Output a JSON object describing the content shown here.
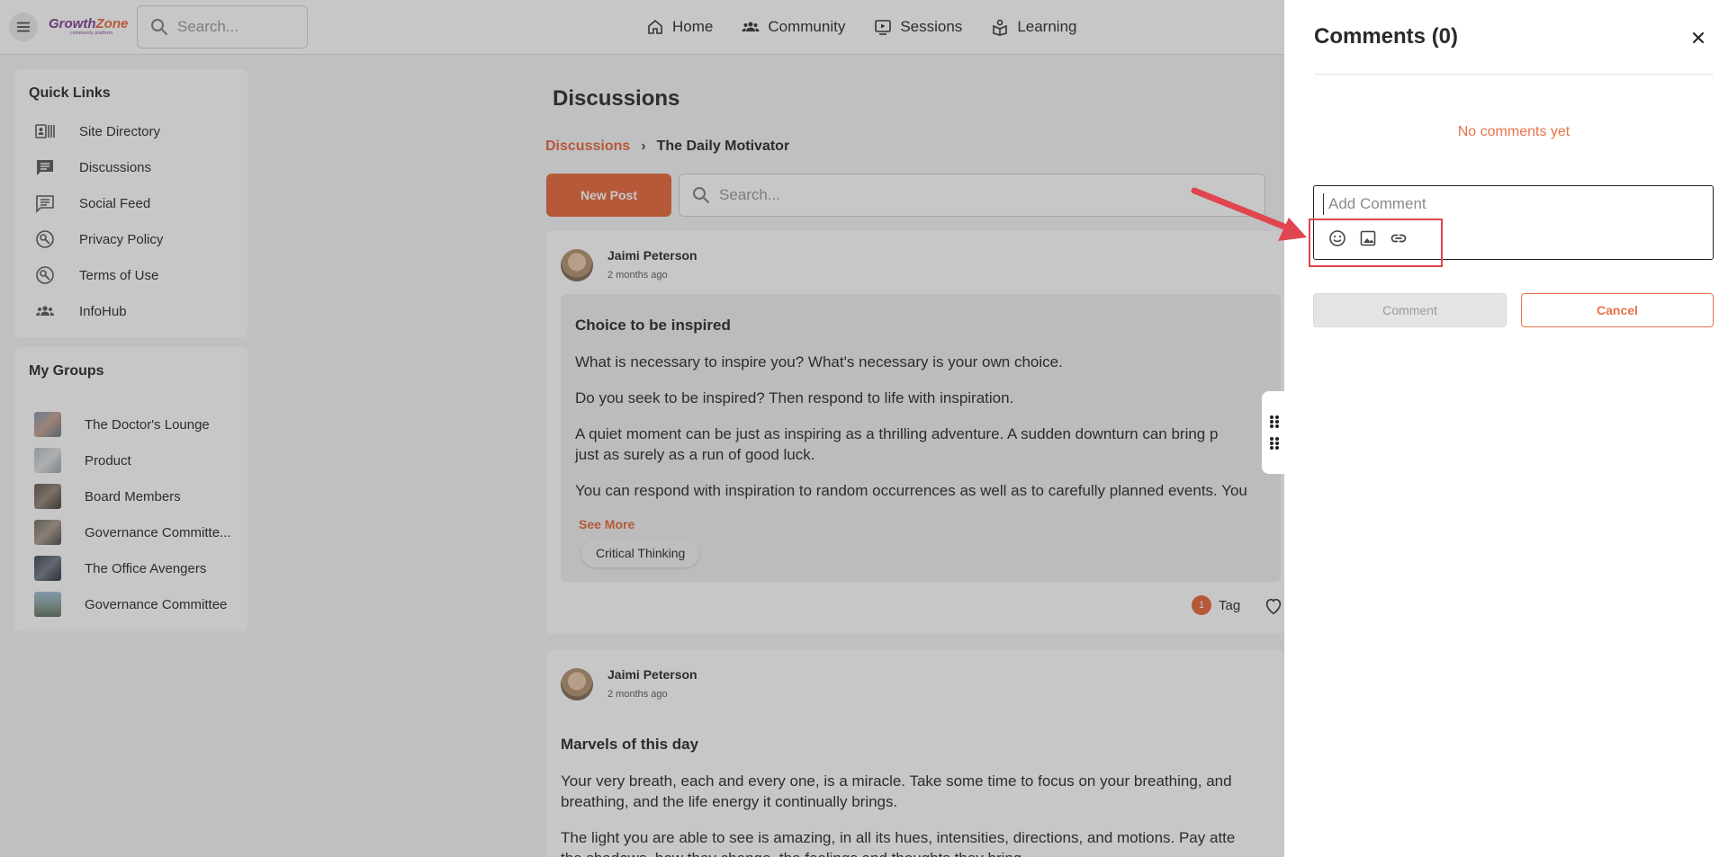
{
  "header": {
    "logo_main": "Growth",
    "logo_accent": "Zone",
    "logo_sub": "community platform",
    "search_placeholder": "Search...",
    "nav": [
      {
        "label": "Home",
        "icon": "home-icon"
      },
      {
        "label": "Community",
        "icon": "community-icon"
      },
      {
        "label": "Sessions",
        "icon": "sessions-icon"
      },
      {
        "label": "Learning",
        "icon": "learning-icon"
      }
    ]
  },
  "sidebar": {
    "quick_links_title": "Quick Links",
    "quick_links": [
      {
        "label": "Site Directory",
        "icon": "directory-icon"
      },
      {
        "label": "Discussions",
        "icon": "discussion-icon"
      },
      {
        "label": "Social Feed",
        "icon": "feed-icon"
      },
      {
        "label": "Privacy Policy",
        "icon": "policy-icon"
      },
      {
        "label": "Terms of Use",
        "icon": "terms-icon"
      },
      {
        "label": "InfoHub",
        "icon": "people-icon"
      }
    ],
    "groups_title": "My Groups",
    "groups": [
      {
        "label": "The Doctor's Lounge"
      },
      {
        "label": "Product"
      },
      {
        "label": "Board Members"
      },
      {
        "label": "Governance Committe..."
      },
      {
        "label": "The Office Avengers"
      },
      {
        "label": "Governance Committee"
      }
    ]
  },
  "main": {
    "title": "Discussions",
    "breadcrumb_link": "Discussions",
    "breadcrumb_sep": "›",
    "breadcrumb_current": "The Daily Motivator",
    "new_post_label": "New Post",
    "search_placeholder": "Search...",
    "posts": [
      {
        "author": "Jaimi Peterson",
        "time": "2 months ago",
        "title": "Choice to be inspired",
        "paragraphs": [
          "What is necessary to inspire you? What's necessary is your own choice.",
          "Do you seek to be inspired? Then respond to life with inspiration.",
          "A quiet moment can be just as inspiring as a thrilling adventure. A sudden downturn can bring p",
          "just as surely as a run of good luck.",
          "You can respond with inspiration to random occurrences as well as to carefully planned events. You"
        ],
        "see_more": "See More",
        "tag": "Critical Thinking",
        "tag_count": "1",
        "tag_label": "Tag"
      },
      {
        "author": "Jaimi Peterson",
        "time": "2 months ago",
        "title": "Marvels of this day",
        "paragraphs": [
          "Your very breath, each and every one, is a miracle. Take some time to focus on your breathing, and",
          "breathing, and the life energy it continually brings.",
          "The light you are able to see is amazing, in all its hues, intensities, directions, and motions. Pay atte",
          "the shadows, how they change, the feelings and thoughts they bring."
        ]
      }
    ]
  },
  "comments_panel": {
    "title": "Comments (0)",
    "empty_text": "No comments yet",
    "input_placeholder": "Add Comment",
    "comment_button": "Comment",
    "cancel_button": "Cancel"
  },
  "colors": {
    "accent": "#e8734a",
    "highlight": "#e0464f"
  }
}
